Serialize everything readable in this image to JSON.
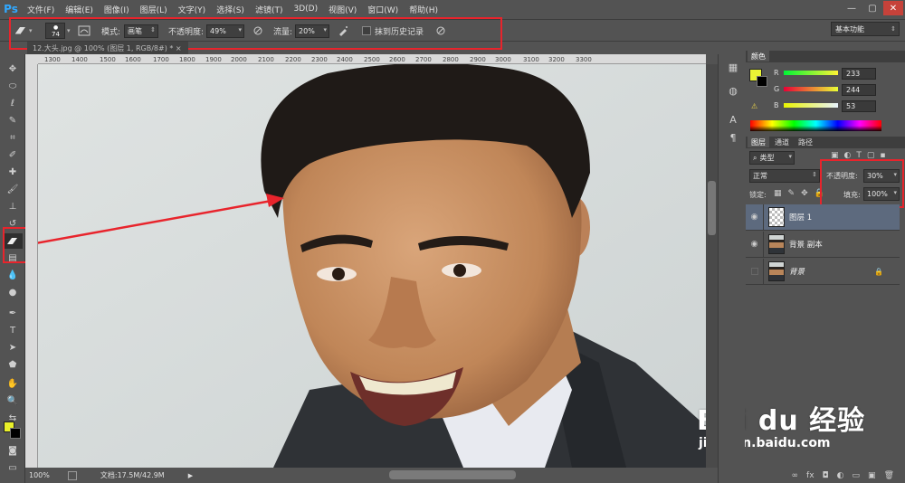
{
  "app": {
    "logo": "Ps"
  },
  "menu": [
    "文件(F)",
    "编辑(E)",
    "图像(I)",
    "图层(L)",
    "文字(Y)",
    "选择(S)",
    "滤镜(T)",
    "3D(D)",
    "视图(V)",
    "窗口(W)",
    "帮助(H)"
  ],
  "window_buttons": [
    "—",
    "▢",
    "✕"
  ],
  "options": {
    "brush_size": "74",
    "mode_label": "模式:",
    "mode_value": "画笔",
    "opacity_label": "不透明度:",
    "opacity_value": "49%",
    "flow_label": "流量:",
    "flow_value": "20%",
    "history_label": "抹到历史记录",
    "workspace": "基本功能"
  },
  "document": {
    "tab_title": "12.大头.jpg @ 100% (图层 1, RGB/8#) *  ×"
  },
  "ruler": {
    "labels": [
      "1300",
      "1400",
      "1500",
      "1600",
      "1700",
      "1800",
      "1900",
      "2000",
      "2100",
      "2200",
      "2300",
      "2400",
      "2500",
      "2600",
      "2700",
      "2800",
      "2900",
      "3000",
      "3100",
      "3200",
      "3300"
    ]
  },
  "status": {
    "zoom": "100%",
    "doc_info": "文档:17.5M/42.9M"
  },
  "color_panel": {
    "tab": "颜色",
    "r_label": "R",
    "r_value": "233",
    "g_label": "G",
    "g_value": "244",
    "b_label": "B",
    "b_value": "53",
    "fg_color": "#e9f435",
    "bg_color": "#000000"
  },
  "layers_panel": {
    "tabs": [
      "图层",
      "通道",
      "路径"
    ],
    "filter": "类型",
    "blend_mode": "正常",
    "opacity_label": "不透明度:",
    "opacity_value": "30%",
    "lock_label": "锁定:",
    "fill_label": "填充:",
    "fill_value": "100%",
    "layers": [
      {
        "name": "图层 1",
        "visible": true,
        "selected": true
      },
      {
        "name": "背景 副本",
        "visible": true,
        "selected": false
      },
      {
        "name": "背景",
        "visible": false,
        "selected": false,
        "locked": true
      }
    ]
  },
  "watermark": {
    "main": "Bai du 经验",
    "sub": "jingyan.baidu.com"
  }
}
